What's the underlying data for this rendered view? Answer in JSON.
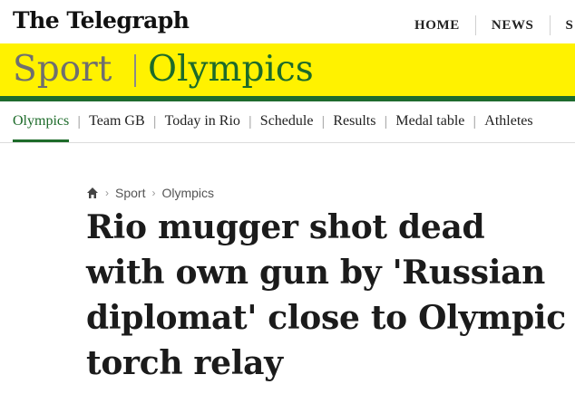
{
  "masthead": {
    "logo_text": "The Telegraph",
    "nav": [
      "HOME",
      "NEWS",
      "S"
    ]
  },
  "banner": {
    "sport_label": "Sport",
    "section_label": "Olympics",
    "colors": {
      "banner_bg": "#fff200",
      "section_green": "#1d6b2a",
      "sport_grey": "#6f6f6f"
    }
  },
  "subnav": {
    "items": [
      "Olympics",
      "Team GB",
      "Today in Rio",
      "Schedule",
      "Results",
      "Medal table",
      "Athletes"
    ],
    "active": "Olympics"
  },
  "breadcrumb": {
    "icon": "home-icon",
    "items": [
      "Sport",
      "Olympics"
    ]
  },
  "article": {
    "headline": "Rio mugger shot dead with own gun by 'Russian diplomat' close to Olympic torch relay"
  }
}
